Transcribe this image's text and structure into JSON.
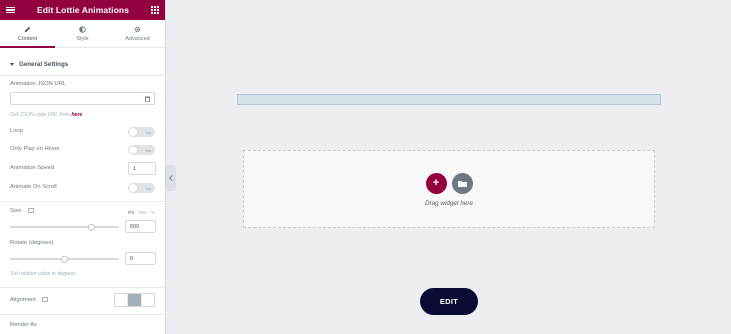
{
  "header": {
    "title": "Edit Lottie Animations"
  },
  "tabs": [
    {
      "label": "Content",
      "icon": "pencil-icon",
      "active": true
    },
    {
      "label": "Style",
      "icon": "half-circle-icon",
      "active": false
    },
    {
      "label": "Advanced",
      "icon": "gear-icon",
      "active": false
    }
  ],
  "section": {
    "title": "General Settings"
  },
  "controls": {
    "json_url": {
      "label": "Animation JSON URL",
      "value": "",
      "helper_text": "Get JSON code URL from",
      "helper_link": "here"
    },
    "loop": {
      "label": "Loop",
      "toggle_text": "No",
      "on": false
    },
    "hover": {
      "label": "Only Play on Hover",
      "toggle_text": "No",
      "on": false
    },
    "speed": {
      "label": "Animation Speed",
      "value": "1"
    },
    "scroll": {
      "label": "Animate On Scroll",
      "toggle_text": "No",
      "on": false
    },
    "size": {
      "label": "Size",
      "units": [
        "PX",
        "EM",
        "%"
      ],
      "active_unit": "PX",
      "value": "600",
      "slider_fraction": 0.75
    },
    "rotate": {
      "label": "Rotate (degrees)",
      "value": "0",
      "slider_fraction": 0.5,
      "helper_text": "Set rotation value in degress"
    },
    "alignment": {
      "label": "Alignment",
      "active_index": 1
    },
    "render_as": {
      "label": "Render As"
    }
  },
  "canvas": {
    "drop_text": "Drag widget here",
    "add_symbol": "+",
    "edit_label": "EDIT"
  },
  "colors": {
    "brand": "#93003f",
    "edit_button": "#0a0a33"
  }
}
